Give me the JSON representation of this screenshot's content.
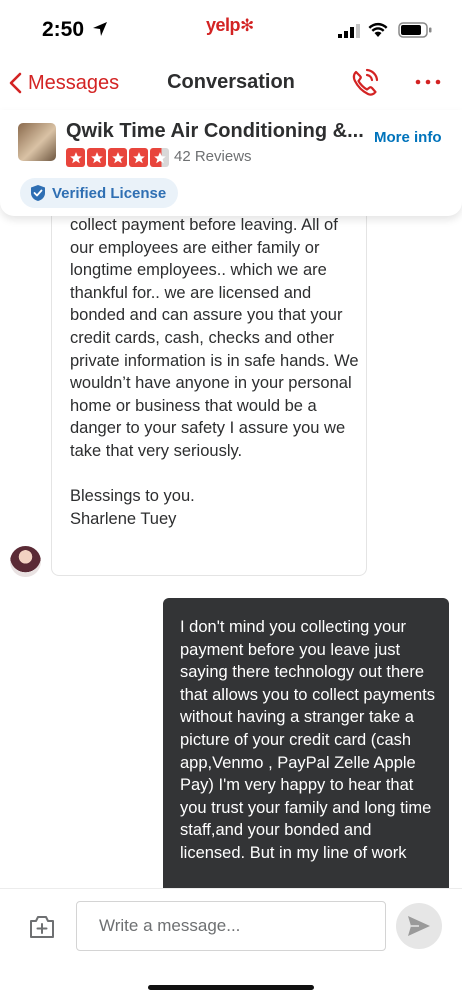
{
  "status_bar": {
    "time": "2:50",
    "carrier_logo": "yelp"
  },
  "nav": {
    "back_label": "Messages",
    "title": "Conversation",
    "call_icon": "phone-call-icon",
    "more_icon": "more-dots-icon"
  },
  "business": {
    "name": "Qwik Time Air Conditioning &...",
    "rating_stars": 4.5,
    "reviews": "42 Reviews",
    "more_info": "More info",
    "verified_label": "Verified License"
  },
  "conversation": {
    "incoming": {
      "text": "collect payment before leaving. All of our employees are either family or longtime employees.. which we are thankful for.. we are licensed and bonded and can assure you that your credit cards, cash, checks and other private information is in safe hands. We wouldn’t have anyone in your personal home or business that would be a danger to your safety I assure you we take that very seriously.\n\nBlessings to you.\nSharlene Tuey"
    },
    "outgoing": {
      "text": "I don't mind you collecting your payment before you leave just saying there technology out there that allows you to collect payments without having a stranger take a picture of your credit card (cash app,Venmo , PayPal Zelle Apple Pay) I'm very happy to hear that you trust your family and long time staff,and your bonded and licensed. But in my line of work"
    }
  },
  "composer": {
    "placeholder": "Write a message..."
  },
  "colors": {
    "brand_red": "#d32323",
    "link_blue": "#0073bb",
    "outgoing_bubble": "#333436"
  }
}
